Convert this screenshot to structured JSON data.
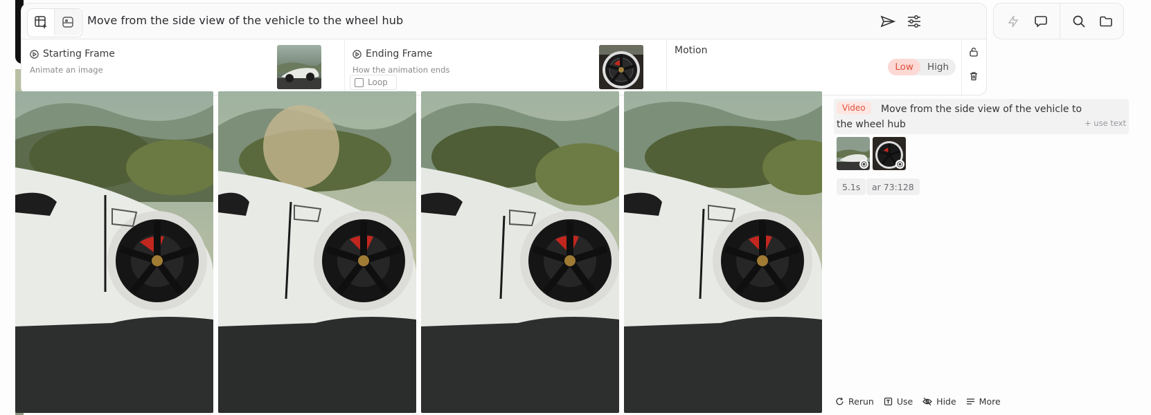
{
  "prompt_bar": {
    "prompt": "Move from the side view of the vehicle to the wheel hub"
  },
  "frames": {
    "start_title": "Starting Frame",
    "start_sub": "Animate an image",
    "end_title": "Ending Frame",
    "end_sub": "How the animation ends",
    "loop_label": "Loop",
    "motion_title": "Motion",
    "motion_low": "Low",
    "motion_high": "High",
    "motion_selected": "Low"
  },
  "info": {
    "tag": "Video",
    "prompt": "Move from the side view of the vehicle to the wheel hub",
    "use_text": "+ use text",
    "duration": "5.1s",
    "aspect": "ar 73:128"
  },
  "footer": {
    "rerun": "Rerun",
    "use": "Use",
    "hide": "Hide",
    "more": "More"
  },
  "icons": {
    "tool1": "add-video-frame-icon",
    "tool2": "image-panel-icon",
    "send": "send-icon",
    "settings": "sliders-icon",
    "flash": "lightning-icon",
    "chat": "chat-icon",
    "search": "search-icon",
    "folder": "folder-icon",
    "unlock": "unlock-icon",
    "trash": "trash-icon"
  },
  "colors": {
    "accent": "#e0503b",
    "accent_bg": "#fcd9d4"
  }
}
